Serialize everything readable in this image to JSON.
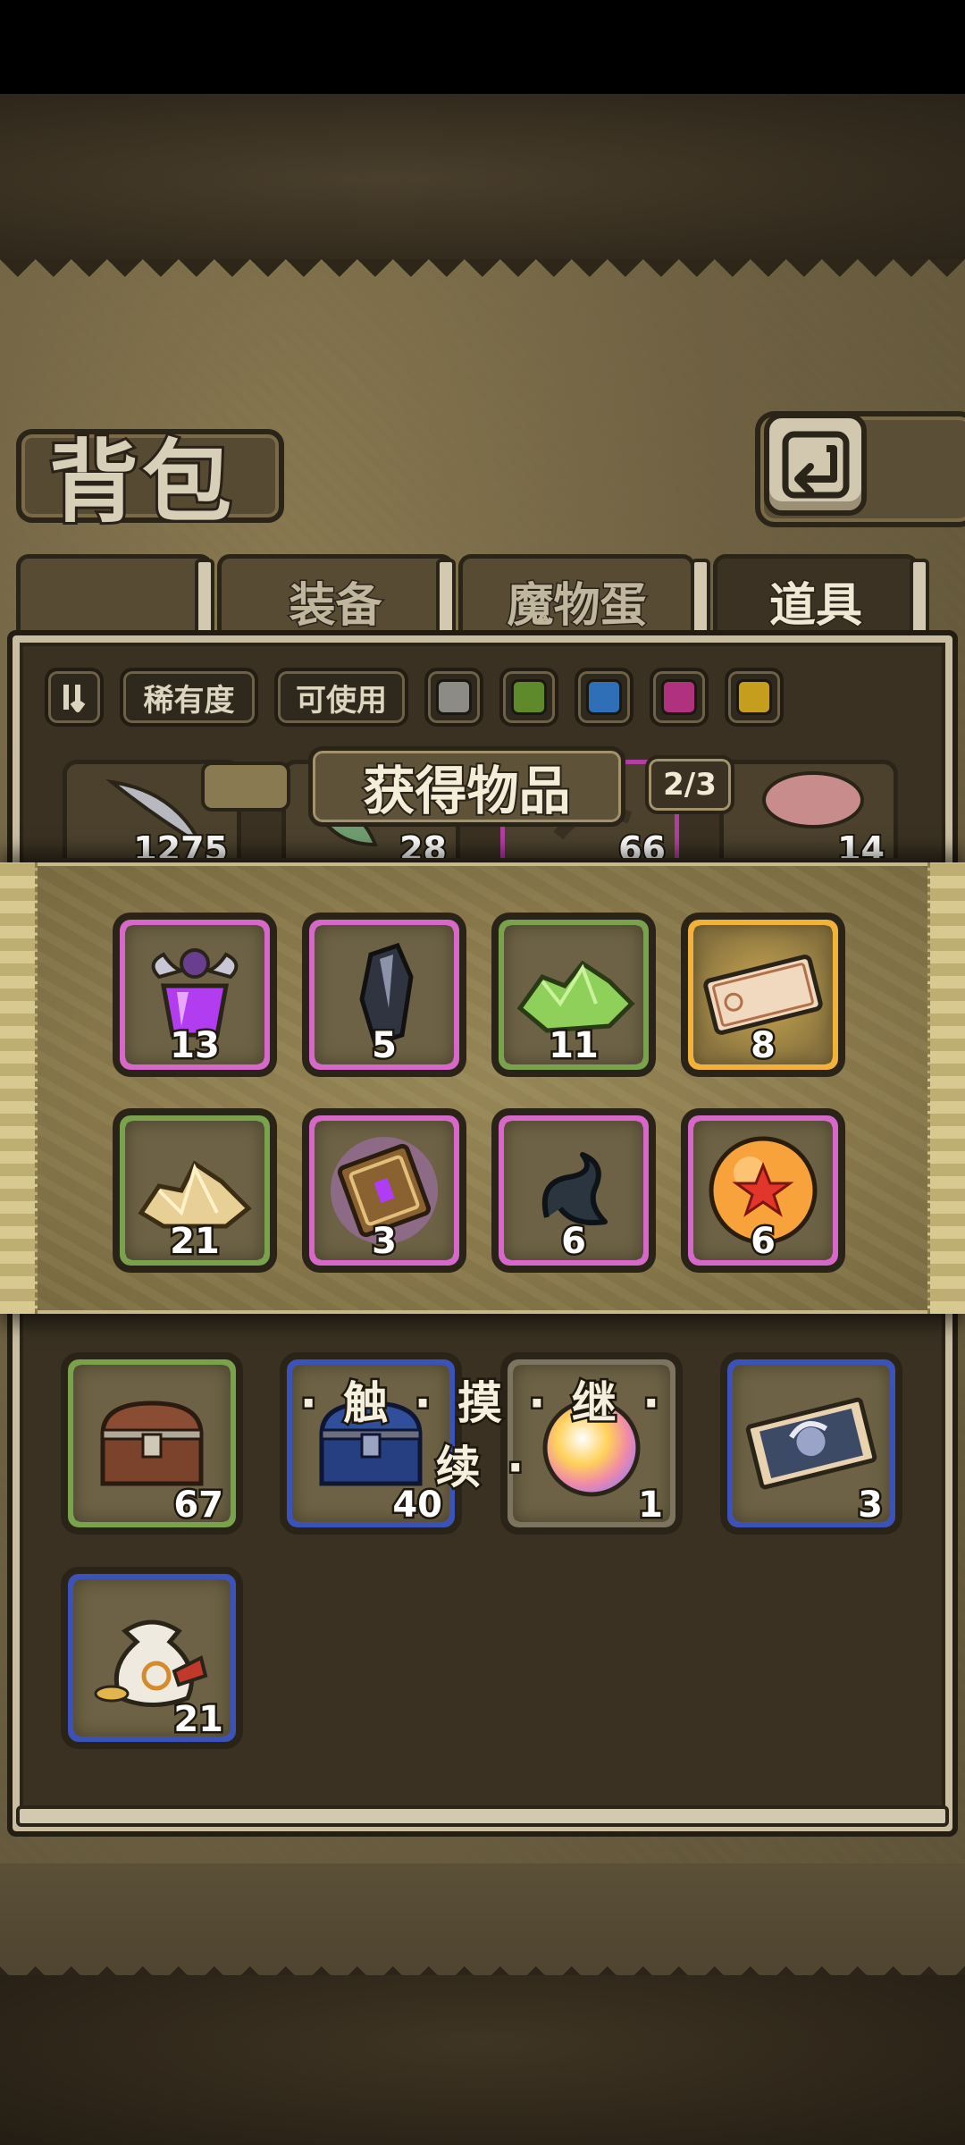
{
  "header": {
    "title": "背包",
    "back_icon": "return-arrow-icon"
  },
  "tabs": [
    {
      "label": "装备",
      "active": false
    },
    {
      "label": "魔物蛋",
      "active": false
    },
    {
      "label": "道具",
      "active": true
    }
  ],
  "filters": {
    "sort_icon": "sort-toggle-icon",
    "rarity_label": "稀有度",
    "usable_label": "可使用",
    "colors": [
      "#8c8b86",
      "#5e8a2b",
      "#2e6fb8",
      "#b0317e",
      "#c69e1d"
    ]
  },
  "background_items_top": [
    {
      "count": "1275",
      "icon": "feather-icon"
    },
    {
      "count": "28",
      "icon": "herb-icon"
    },
    {
      "count": "66",
      "icon": "claw-icon"
    },
    {
      "count": "14",
      "icon": "meat-icon"
    }
  ],
  "obtain_popup": {
    "title": "获得物品",
    "page": "2/3",
    "items": [
      {
        "icon": "purple-potion-icon",
        "count": "13",
        "rarity": "pink"
      },
      {
        "icon": "dark-crystal-icon",
        "count": "5",
        "rarity": "pink"
      },
      {
        "icon": "green-ore-icon",
        "count": "11",
        "rarity": "green"
      },
      {
        "icon": "ticket-icon",
        "count": "8",
        "rarity": "gold"
      },
      {
        "icon": "gold-ore-icon",
        "count": "21",
        "rarity": "green"
      },
      {
        "icon": "spell-book-icon",
        "count": "3",
        "rarity": "pink"
      },
      {
        "icon": "dark-tentacle-icon",
        "count": "6",
        "rarity": "pink"
      },
      {
        "icon": "star-orb-icon",
        "count": "6",
        "rarity": "pink"
      }
    ]
  },
  "touch_continue": "· 触 · 摸 · 继 · 续 ·",
  "inventory": [
    {
      "icon": "wooden-chest-icon",
      "count": "67",
      "rarity": "green"
    },
    {
      "icon": "blue-chest-icon",
      "count": "40",
      "rarity": "blue"
    },
    {
      "icon": "rainbow-orb-icon",
      "count": "1",
      "rarity": "grey"
    },
    {
      "icon": "character-card-icon",
      "count": "3",
      "rarity": "blue"
    },
    {
      "icon": "coin-bag-icon",
      "count": "21",
      "rarity": "blue"
    }
  ]
}
